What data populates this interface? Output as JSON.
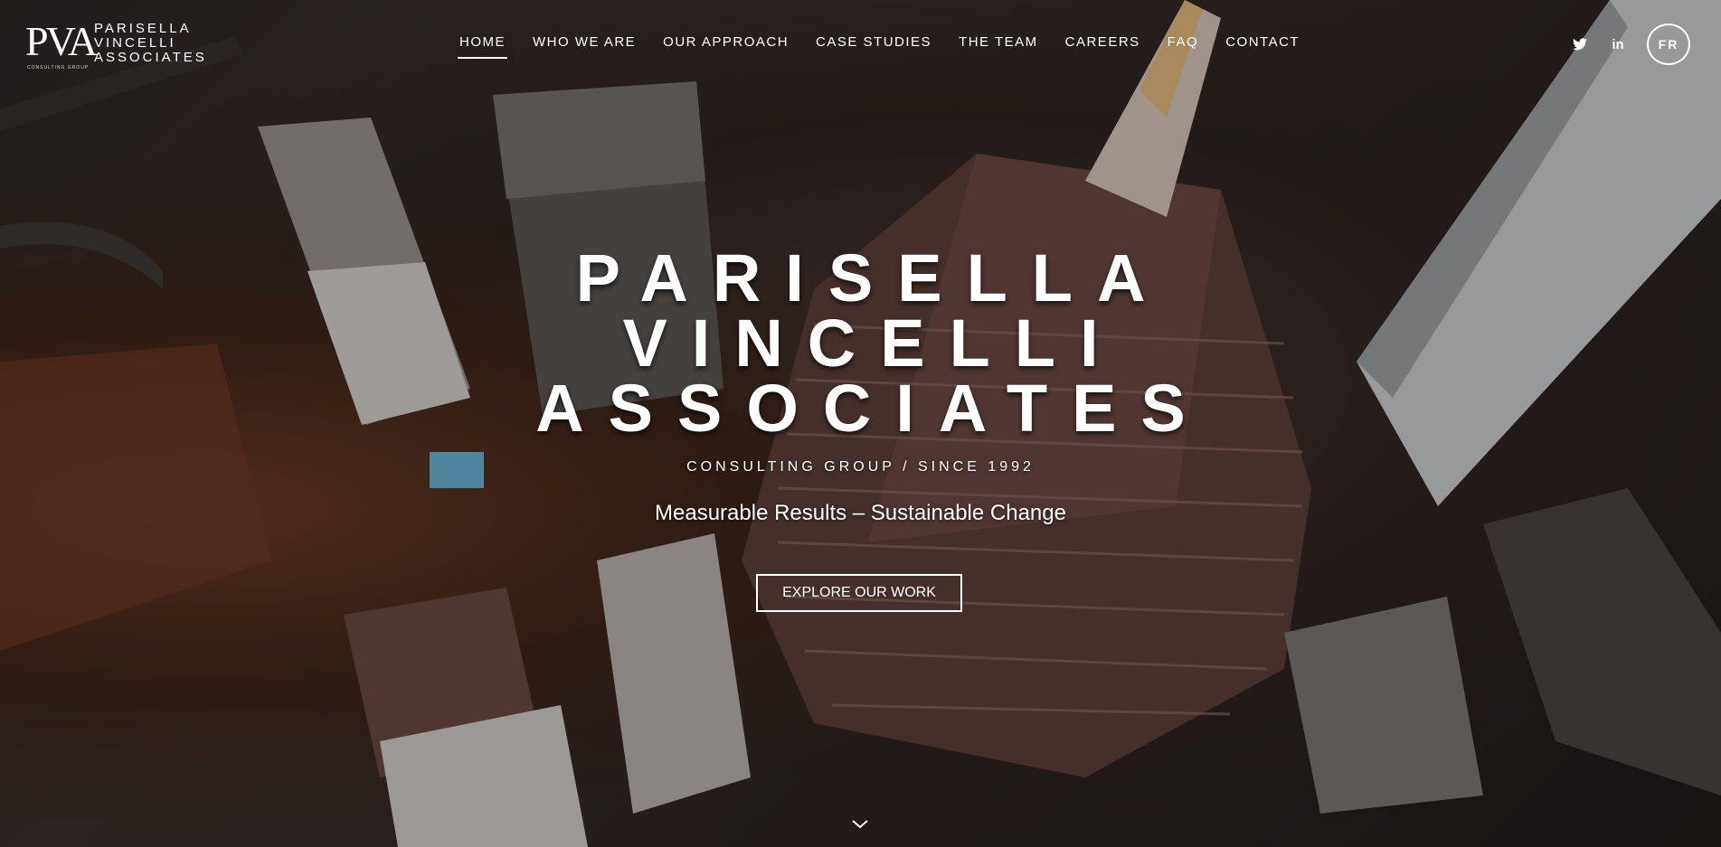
{
  "logo": {
    "monogram": "PVA",
    "line1": "PARISELLA",
    "line2": "VINCELLI",
    "line3": "ASSOCIATES",
    "tag": "CONSULTING GROUP"
  },
  "nav": {
    "items": [
      {
        "label": "HOME",
        "active": true
      },
      {
        "label": "WHO WE ARE"
      },
      {
        "label": "OUR APPROACH"
      },
      {
        "label": "CASE STUDIES"
      },
      {
        "label": "THE TEAM"
      },
      {
        "label": "CAREERS"
      },
      {
        "label": "FAQ"
      },
      {
        "label": "CONTACT"
      }
    ]
  },
  "social": {
    "twitter_icon": "twitter-icon",
    "linkedin_icon": "linkedin-icon",
    "linkedin_text": "in",
    "language": "FR"
  },
  "hero": {
    "title_line1": "PARISELLA",
    "title_line2": "VINCELLI",
    "title_line3": "ASSOCIATES",
    "subtitle": "CONSULTING GROUP / SINCE 1992",
    "tagline": "Measurable Results – Sustainable Change",
    "cta": "EXPLORE OUR WORK",
    "scroll_icon": "chevron-down-icon"
  }
}
